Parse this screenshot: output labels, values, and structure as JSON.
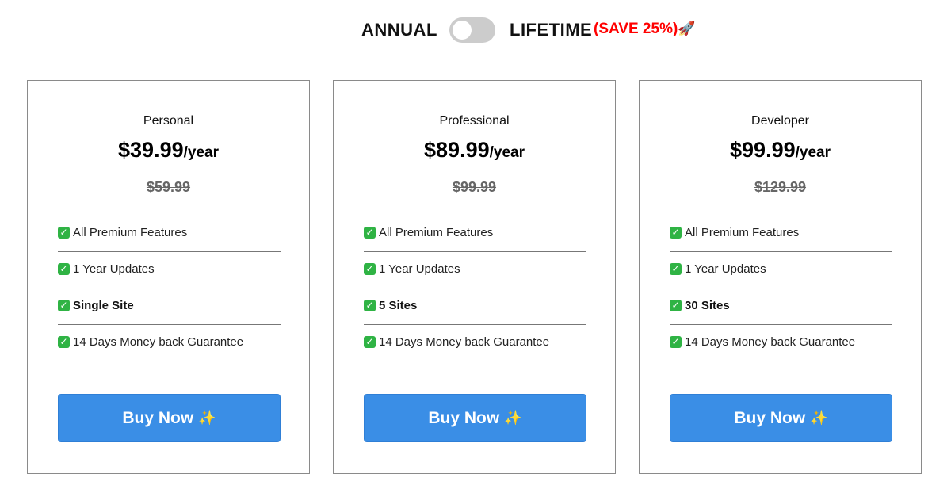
{
  "billing_toggle": {
    "annual_label": "ANNUAL",
    "lifetime_label": "LIFETIME",
    "save_label": "(SAVE 25%)",
    "save_icon": "rocket-icon",
    "save_icon_glyph": "🚀",
    "state": "annual",
    "save_color": "#ff0000"
  },
  "plans": [
    {
      "name": "Personal",
      "price": "$39.99",
      "period": "/year",
      "old_price": "$59.99",
      "features": [
        {
          "text": "All Premium Features",
          "bold": false
        },
        {
          "text": "1 Year Updates",
          "bold": false
        },
        {
          "text": "Single Site",
          "bold": true
        },
        {
          "text": "14 Days Money back Guarantee",
          "bold": false
        }
      ],
      "button_label": "Buy Now",
      "button_icon": "sparkles-icon"
    },
    {
      "name": "Professional",
      "price": "$89.99",
      "period": "/year",
      "old_price": "$99.99",
      "features": [
        {
          "text": "All Premium Features",
          "bold": false
        },
        {
          "text": "1 Year Updates",
          "bold": false
        },
        {
          "text": "5 Sites",
          "bold": true
        },
        {
          "text": "14 Days Money back Guarantee",
          "bold": false
        }
      ],
      "button_label": "Buy Now",
      "button_icon": "sparkles-icon"
    },
    {
      "name": "Developer",
      "price": "$99.99",
      "period": "/year",
      "old_price": "$129.99",
      "features": [
        {
          "text": "All Premium Features",
          "bold": false
        },
        {
          "text": "1 Year Updates",
          "bold": false
        },
        {
          "text": "30 Sites",
          "bold": true
        },
        {
          "text": "14 Days Money back Guarantee",
          "bold": false
        }
      ],
      "button_label": "Buy Now",
      "button_icon": "sparkles-icon"
    }
  ],
  "colors": {
    "button": "#3a8ee6",
    "check": "#2fb344",
    "toggle_track": "#cccccc"
  },
  "icons": {
    "check_glyph": "✓",
    "sparkles_glyph": "✨"
  }
}
